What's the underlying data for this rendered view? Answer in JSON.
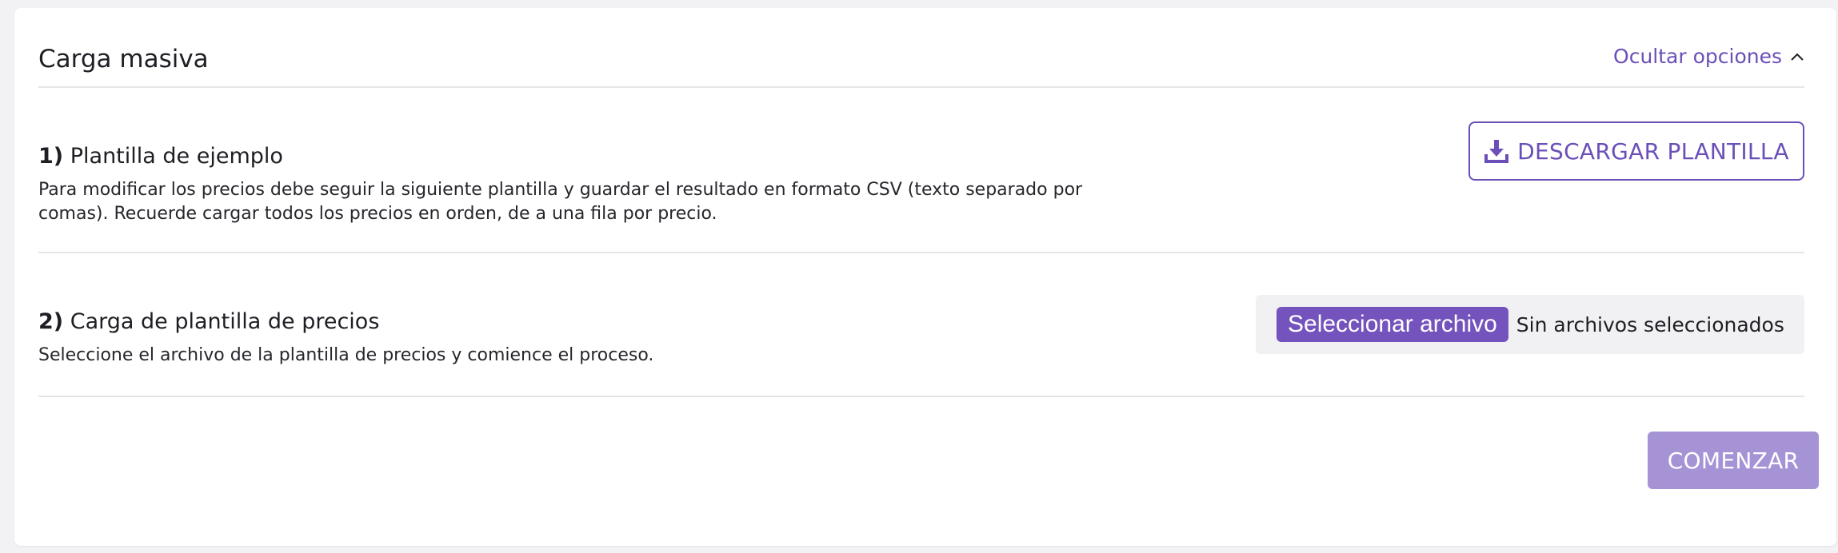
{
  "header": {
    "title": "Carga masiva",
    "toggle_label": "Ocultar opciones",
    "toggle_icon": "chevron-up-icon"
  },
  "step1": {
    "number": "1)",
    "title": "Plantilla de ejemplo",
    "description": "Para modificar los precios debe seguir la siguiente plantilla y guardar el resultado en formato CSV (texto separado por comas). Recuerde cargar todos los precios en orden, de a una fila por precio.",
    "download_label": "DESCARGAR PLANTILLA",
    "download_icon": "download-icon"
  },
  "step2": {
    "number": "2)",
    "title": "Carga de plantilla de precios",
    "description": "Seleccione el archivo de la plantilla de precios y comience el proceso.",
    "file_button_label": "Seleccionar archivo",
    "file_status": "Sin archivos seleccionados"
  },
  "actions": {
    "start_label": "COMENZAR",
    "start_enabled": false
  },
  "colors": {
    "accent": "#6b4fb8",
    "file_button": "#7453bd",
    "start_disabled": "#a693d5",
    "divider": "#e6e6ea"
  }
}
